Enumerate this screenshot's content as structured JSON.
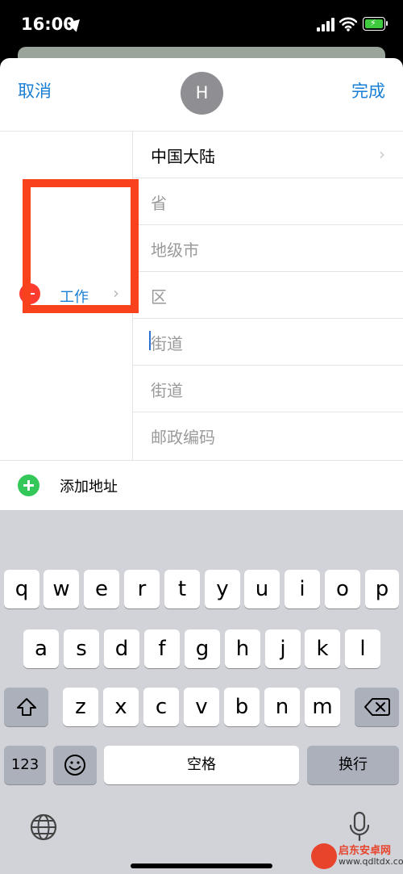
{
  "status": {
    "time": "16:00"
  },
  "nav": {
    "cancel": "取消",
    "done": "完成",
    "avatar_initial": "H"
  },
  "address": {
    "label": "工作",
    "country": "中国大陆",
    "placeholders": {
      "province": "省",
      "city": "地级市",
      "district": "区",
      "street1": "街道",
      "street2": "街道",
      "postal": "邮政编码"
    }
  },
  "add_address": "添加地址",
  "keyboard": {
    "row1": [
      "q",
      "w",
      "e",
      "r",
      "t",
      "y",
      "u",
      "i",
      "o",
      "p"
    ],
    "row2": [
      "a",
      "s",
      "d",
      "f",
      "g",
      "h",
      "j",
      "k",
      "l"
    ],
    "row3": [
      "z",
      "x",
      "c",
      "v",
      "b",
      "n",
      "m"
    ],
    "numbers": "123",
    "space": "空格",
    "return": "换行"
  },
  "watermark": {
    "name": "启东安卓网",
    "url": "www.qdltdx.com"
  }
}
